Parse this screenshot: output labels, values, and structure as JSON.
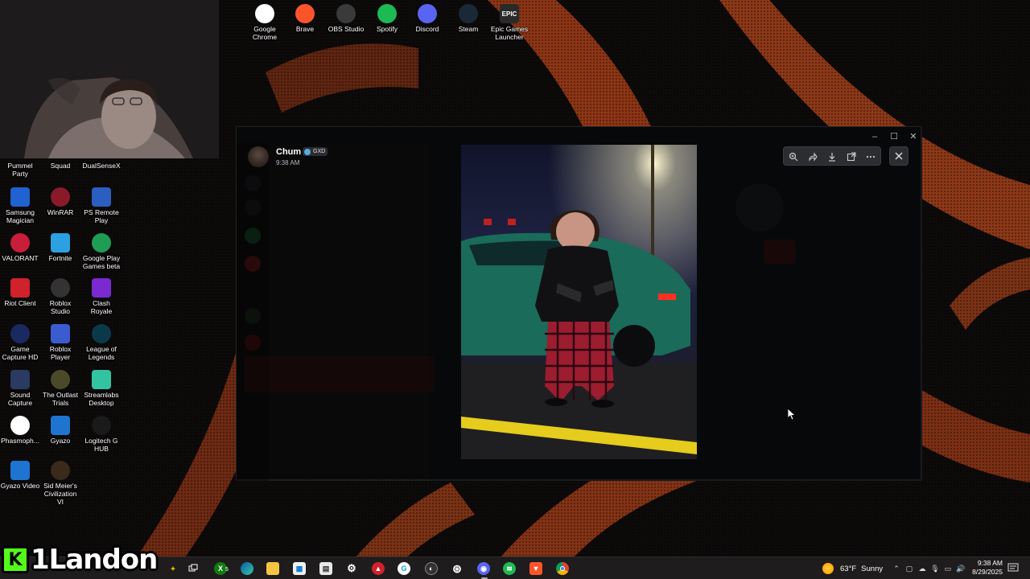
{
  "desktop_top_icons": [
    {
      "label": "Google\nChrome",
      "icon": "chrome-icon"
    },
    {
      "label": "Brave",
      "icon": "brave-icon"
    },
    {
      "label": "OBS Studio",
      "icon": "obs-icon"
    },
    {
      "label": "Spotify",
      "icon": "spotify-icon"
    },
    {
      "label": "Discord",
      "icon": "discord-icon"
    },
    {
      "label": "Steam",
      "icon": "steam-icon"
    },
    {
      "label": "Epic Games\nLauncher",
      "icon": "epic-games-icon",
      "glyph": "EPIC"
    }
  ],
  "desktop_left_icons": [
    {
      "label": "Pummel\nParty"
    },
    {
      "label": "Squad"
    },
    {
      "label": "DualSenseX"
    },
    {
      "label": "Samsung\nMagician"
    },
    {
      "label": "WinRAR"
    },
    {
      "label": "PS Remote\nPlay"
    },
    {
      "label": "VALORANT"
    },
    {
      "label": "Fortnite"
    },
    {
      "label": "Google Play\nGames beta"
    },
    {
      "label": "Riot Client"
    },
    {
      "label": "Roblox\nStudio"
    },
    {
      "label": "Clash Royale"
    },
    {
      "label": "Game\nCapture HD"
    },
    {
      "label": "Roblox Player"
    },
    {
      "label": "League of\nLegends"
    },
    {
      "label": "Sound\nCapture"
    },
    {
      "label": "The Outlast\nTrials"
    },
    {
      "label": "Streamlabs\nDesktop"
    },
    {
      "label": "Phasmoph..."
    },
    {
      "label": "Gyazo"
    },
    {
      "label": "Logitech G\nHUB"
    },
    {
      "label": "Gyazo Video"
    },
    {
      "label": "Sid Meier's\nCivilization VI"
    }
  ],
  "viewer": {
    "username": "Chum",
    "badge": "GXD",
    "time": "9:38 AM"
  },
  "toolbar_icons": [
    "zoom-in-icon",
    "forward-icon",
    "download-icon",
    "open-external-icon",
    "more-icon"
  ],
  "streamer": {
    "platform_glyph": "K",
    "name": "1Landon"
  },
  "weather": {
    "temp": "63°F",
    "condition": "Sunny"
  },
  "clock": {
    "time": "9:38 AM",
    "date": "8/29/2025"
  },
  "taskbar_badge": "5",
  "colors": {
    "accent_orange": "#d9501c",
    "kick_green": "#53fc18",
    "discord_blurple": "#5865f2",
    "spotify_green": "#1db954"
  }
}
